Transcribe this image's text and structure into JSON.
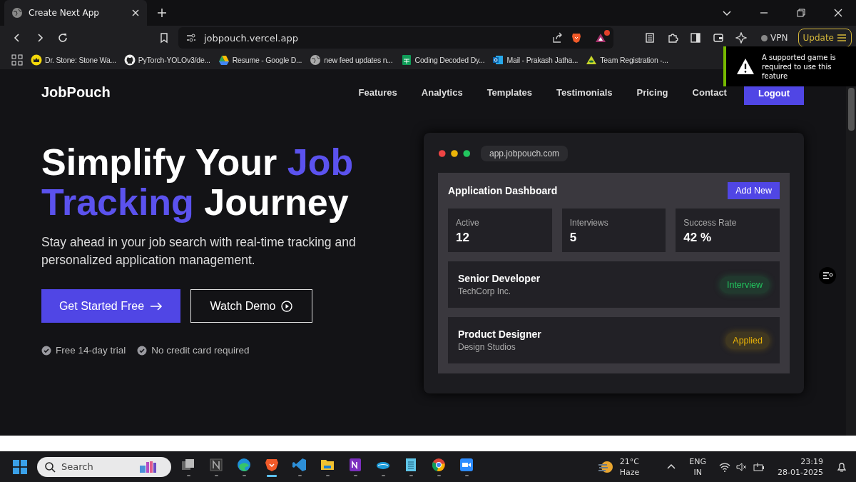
{
  "browser": {
    "tab_title": "Create Next App",
    "url": "jobpouch.vercel.app",
    "vpn": "VPN",
    "update": "Update",
    "bookmarks": [
      {
        "kind": "crown",
        "label": "Dr. Stone: Stone Wa..."
      },
      {
        "kind": "github",
        "label": "PyTorch-YOLOv3/de..."
      },
      {
        "kind": "drive",
        "label": "Resume - Google D..."
      },
      {
        "kind": "globe",
        "label": "new feed updates n..."
      },
      {
        "kind": "sheets",
        "label": "Coding Decoded Dy..."
      },
      {
        "kind": "outlook",
        "label": "Mail - Prakash Jatha..."
      },
      {
        "kind": "eye",
        "label": "Team Registration -..."
      }
    ]
  },
  "notification": {
    "text": "A supported game is required to use this feature"
  },
  "site": {
    "brand": "JobPouch",
    "nav": [
      {
        "label": "Features",
        "kind": "link"
      },
      {
        "label": "Analytics",
        "kind": "link"
      },
      {
        "label": "Templates",
        "kind": "link"
      },
      {
        "label": "Testimonials",
        "kind": "link"
      },
      {
        "label": "Pricing",
        "kind": "link"
      },
      {
        "label": "Contact",
        "kind": "link"
      },
      {
        "label": "Logout",
        "kind": "button"
      }
    ],
    "hero_title": [
      [
        {
          "text": "Simplify Your ",
          "accent": false
        },
        {
          "text": "Job",
          "accent": true
        }
      ],
      [
        {
          "text": "Tracking",
          "accent": true
        },
        {
          "text": " Journey",
          "accent": false
        }
      ]
    ],
    "hero_subtitle": "Stay ahead in your job search with real-time tracking and personalized application management.",
    "primary_button": "Get Started Free",
    "secondary_button": "Watch Demo",
    "perks": [
      "Free 14-day trial",
      "No credit card required"
    ],
    "mockup": {
      "url": "app.jobpouch.com",
      "title": "Application Dashboard",
      "add_button": "Add New",
      "stats": [
        {
          "label": "Active",
          "value": "12"
        },
        {
          "label": "Interviews",
          "value": "5"
        },
        {
          "label": "Success Rate",
          "value": "42 %"
        }
      ],
      "applications": [
        {
          "role": "Senior Developer",
          "company": "TechCorp Inc.",
          "status": "Interview",
          "color": "#22c55e"
        },
        {
          "role": "Product Designer",
          "company": "Design Studios",
          "status": "Applied",
          "color": "#eab308"
        }
      ]
    }
  },
  "taskbar": {
    "search_placeholder": "Search",
    "apps": [
      {
        "kind": "taskview",
        "active": false
      },
      {
        "kind": "notion",
        "active": false
      },
      {
        "kind": "edge",
        "active": false
      },
      {
        "kind": "brave",
        "active": true
      },
      {
        "kind": "vscode",
        "active": false
      },
      {
        "kind": "files",
        "active": false
      },
      {
        "kind": "onenote",
        "active": false
      },
      {
        "kind": "cloud",
        "active": false
      },
      {
        "kind": "notepad",
        "active": false
      },
      {
        "kind": "chrome",
        "active": false
      },
      {
        "kind": "zoom",
        "active": false
      }
    ],
    "temperature": "21°C",
    "weather": "Haze",
    "lang": "ENG",
    "region": "IN",
    "time": "23:19",
    "date": "28-01-2025"
  }
}
